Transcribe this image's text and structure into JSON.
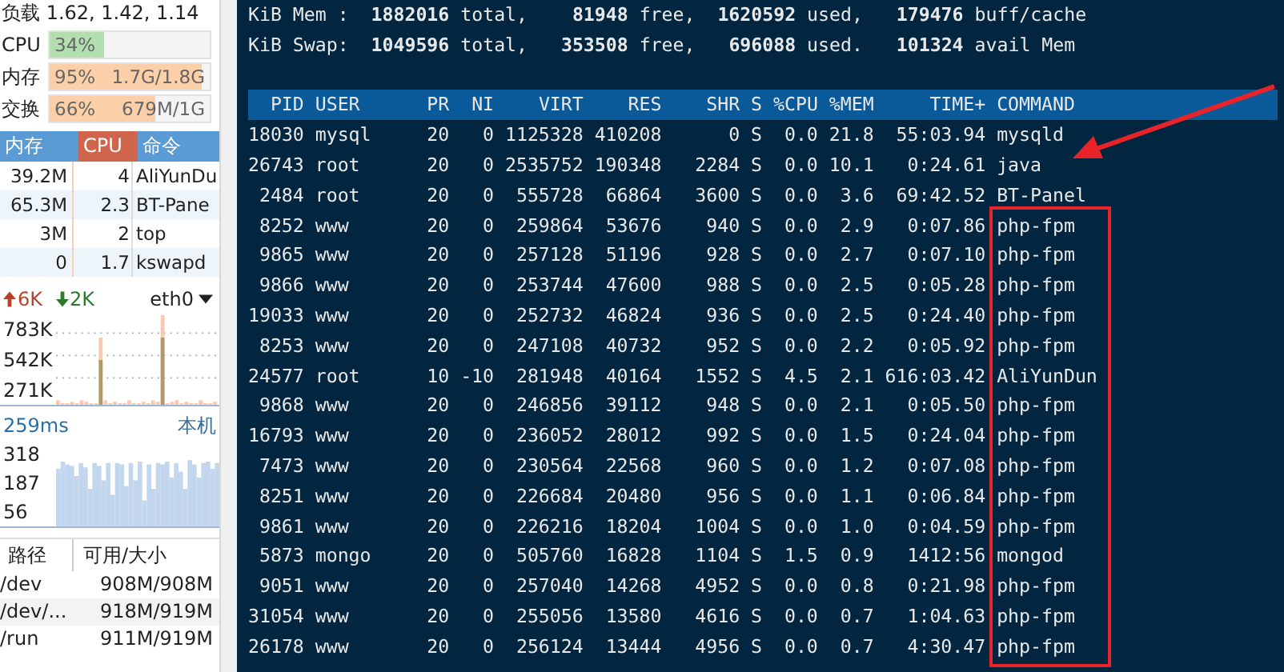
{
  "sidebar": {
    "load": "负载 1.62, 1.42, 1.14",
    "meters": [
      {
        "label": "CPU",
        "level": 0.34,
        "percent": "34%",
        "kind": "cpu"
      },
      {
        "label": "内存",
        "level": 0.95,
        "percent": "95%",
        "value": "1.7G/1.8G",
        "kind": "mem"
      },
      {
        "label": "交换",
        "level": 0.66,
        "percent": "66%",
        "value": "679M/1G",
        "kind": "mem"
      }
    ],
    "process_table": {
      "columns": [
        {
          "label": "内存",
          "selected": false
        },
        {
          "label": "CPU",
          "selected": true
        },
        {
          "label": "命令",
          "selected": false
        }
      ],
      "rows": [
        [
          "39.2M",
          "4",
          "AliYunDu"
        ],
        [
          "65.3M",
          "2.3",
          "BT-Pane"
        ],
        [
          "3M",
          "2",
          "top"
        ],
        [
          "0",
          "1.7",
          "kswapd"
        ]
      ]
    },
    "network": {
      "upload": "6K",
      "download": "2K",
      "interface": "eth0",
      "y_labels": [
        "783K",
        "542K",
        "271K"
      ]
    },
    "ping": {
      "latency": "259ms",
      "host": "本机",
      "y_labels": [
        "318",
        "187",
        "56"
      ]
    },
    "disk_table": {
      "columns": [
        "路径",
        "可用/大小"
      ],
      "rows": [
        [
          "/dev",
          "908M/908M"
        ],
        [
          "/dev/...",
          "918M/919M"
        ],
        [
          "/run",
          "911M/919M"
        ]
      ]
    }
  },
  "terminal": {
    "summary": [
      "KiB Mem :  **1882016** total,    **81948** free,  **1620592** used,   **179476** buff/cache",
      "KiB Swap:  **1049596** total,   **353508** free,   **696088** used.   **101324** avail Mem"
    ],
    "columns": [
      "PID",
      "USER",
      "PR",
      "NI",
      "VIRT",
      "RES",
      "SHR",
      "S",
      "%CPU",
      "%MEM",
      "TIME+",
      "COMMAND"
    ],
    "rows": [
      [
        "18030",
        "mysql",
        "20",
        "0",
        "1125328",
        "410208",
        "0",
        "S",
        "0.0",
        "21.8",
        "55:03.94",
        "mysqld"
      ],
      [
        "26743",
        "root",
        "20",
        "0",
        "2535752",
        "190348",
        "2284",
        "S",
        "0.0",
        "10.1",
        "0:24.61",
        "java"
      ],
      [
        "2484",
        "root",
        "20",
        "0",
        "555728",
        "66864",
        "3600",
        "S",
        "0.0",
        "3.6",
        "69:42.52",
        "BT-Panel"
      ],
      [
        "8252",
        "www",
        "20",
        "0",
        "259864",
        "53676",
        "940",
        "S",
        "0.0",
        "2.9",
        "0:07.86",
        "php-fpm"
      ],
      [
        "9865",
        "www",
        "20",
        "0",
        "257128",
        "51196",
        "928",
        "S",
        "0.0",
        "2.7",
        "0:07.10",
        "php-fpm"
      ],
      [
        "9866",
        "www",
        "20",
        "0",
        "253744",
        "47600",
        "988",
        "S",
        "0.0",
        "2.5",
        "0:05.28",
        "php-fpm"
      ],
      [
        "19033",
        "www",
        "20",
        "0",
        "252732",
        "46824",
        "936",
        "S",
        "0.0",
        "2.5",
        "0:24.40",
        "php-fpm"
      ],
      [
        "8253",
        "www",
        "20",
        "0",
        "247108",
        "40732",
        "952",
        "S",
        "0.0",
        "2.2",
        "0:05.92",
        "php-fpm"
      ],
      [
        "24577",
        "root",
        "10",
        "-10",
        "281948",
        "40164",
        "1552",
        "S",
        "4.5",
        "2.1",
        "616:03.42",
        "AliYunDun"
      ],
      [
        "9868",
        "www",
        "20",
        "0",
        "246856",
        "39112",
        "948",
        "S",
        "0.0",
        "2.1",
        "0:05.50",
        "php-fpm"
      ],
      [
        "16793",
        "www",
        "20",
        "0",
        "236052",
        "28012",
        "992",
        "S",
        "0.0",
        "1.5",
        "0:24.04",
        "php-fpm"
      ],
      [
        "7473",
        "www",
        "20",
        "0",
        "230564",
        "22568",
        "960",
        "S",
        "0.0",
        "1.2",
        "0:07.08",
        "php-fpm"
      ],
      [
        "8251",
        "www",
        "20",
        "0",
        "226684",
        "20480",
        "956",
        "S",
        "0.0",
        "1.1",
        "0:06.84",
        "php-fpm"
      ],
      [
        "9861",
        "www",
        "20",
        "0",
        "226216",
        "18204",
        "1004",
        "S",
        "0.0",
        "1.0",
        "0:04.59",
        "php-fpm"
      ],
      [
        "5873",
        "mongo",
        "20",
        "0",
        "505760",
        "16828",
        "1104",
        "S",
        "1.5",
        "0.9",
        "1412:56",
        "mongod"
      ],
      [
        "9051",
        "www",
        "20",
        "0",
        "257040",
        "14268",
        "4952",
        "S",
        "0.0",
        "0.8",
        "0:21.98",
        "php-fpm"
      ],
      [
        "31054",
        "www",
        "20",
        "0",
        "255056",
        "13580",
        "4616",
        "S",
        "0.0",
        "0.7",
        "1:04.63",
        "php-fpm"
      ],
      [
        "26178",
        "www",
        "20",
        "0",
        "256124",
        "13444",
        "4956",
        "S",
        "0.0",
        "0.7",
        "4:30.47",
        "php-fpm"
      ]
    ]
  }
}
